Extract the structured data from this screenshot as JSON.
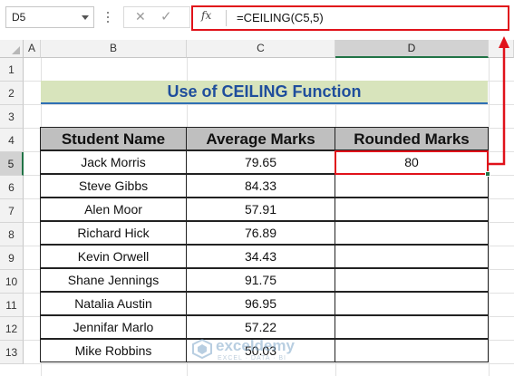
{
  "formula_bar": {
    "name_box": "D5",
    "cancel_icon": "close-icon",
    "enter_icon": "check-icon",
    "fx_label": "fx",
    "formula": "=CEILING(C5,5)"
  },
  "columns": [
    "A",
    "B",
    "C",
    "D"
  ],
  "selected_column": "D",
  "rows": [
    "1",
    "2",
    "3",
    "4",
    "5",
    "6",
    "7",
    "8",
    "9",
    "10",
    "11",
    "12",
    "13"
  ],
  "selected_row": "5",
  "title": "Use of CEILING Function",
  "table": {
    "headers": [
      "Student Name",
      "Average Marks",
      "Rounded Marks"
    ],
    "rows": [
      [
        "Jack Morris",
        "79.65",
        "80"
      ],
      [
        "Steve Gibbs",
        "84.33",
        ""
      ],
      [
        "Alen Moor",
        "57.91",
        ""
      ],
      [
        "Richard Hick",
        "76.89",
        ""
      ],
      [
        "Kevin Orwell",
        "34.43",
        ""
      ],
      [
        "Shane Jennings",
        "91.75",
        ""
      ],
      [
        "Natalia Austin",
        "96.95",
        ""
      ],
      [
        "Jennifar Marlo",
        "57.22",
        ""
      ],
      [
        "Mike Robbins",
        "50.03",
        ""
      ]
    ]
  },
  "colors": {
    "accent_red": "#e0121a",
    "title_fill": "#d8e4bc",
    "title_text": "#1f4e9c",
    "header_fill": "#bfbfbf"
  },
  "watermark": {
    "name": "exceldemy",
    "tagline": "EXCEL · DATA · BI"
  }
}
